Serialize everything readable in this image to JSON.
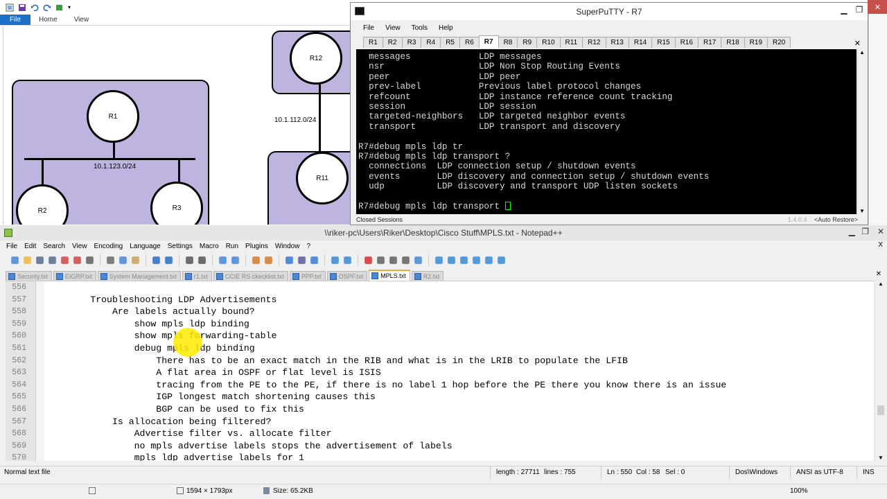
{
  "paint": {
    "tabs": [
      "File",
      "Home",
      "View"
    ],
    "status_size": "1594 × 1793px",
    "status_file": "Size: 65.2KB",
    "zoom": "100%",
    "diagram": {
      "routers": [
        "R1",
        "R2",
        "R3",
        "R12",
        "R11"
      ],
      "networks": [
        "10.1.123.0/24",
        "10.1.112.0/24"
      ]
    }
  },
  "putty": {
    "title": "SuperPuTTY - R7",
    "menu": [
      "File",
      "View",
      "Tools",
      "Help"
    ],
    "tabs": [
      "R1",
      "R2",
      "R3",
      "R4",
      "R5",
      "R6",
      "R7",
      "R8",
      "R9",
      "R10",
      "R11",
      "R12",
      "R13",
      "R14",
      "R15",
      "R16",
      "R17",
      "R18",
      "R19",
      "R20"
    ],
    "active_tab": "R7",
    "terminal_lines": [
      "  messages             LDP messages",
      "  nsr                  LDP Non Stop Routing Events",
      "  peer                 LDP peer",
      "  prev-label           Previous label protocol changes",
      "  refcount             LDP instance reference count tracking",
      "  session              LDP session",
      "  targeted-neighbors   LDP targeted neighbor events",
      "  transport            LDP transport and discovery",
      "",
      "R7#debug mpls ldp tr",
      "R7#debug mpls ldp transport ?",
      "  connections  LDP connection setup / shutdown events",
      "  events       LDP discovery and connection setup / shutdown events",
      "  udp          LDP discovery and transport UDP listen sockets",
      "",
      "R7#debug mpls ldp transport "
    ],
    "status_left": "Closed Sessions",
    "status_version": "1.4.0.4",
    "status_right": "<Auto Restore>"
  },
  "npp": {
    "title": "\\\\riker-pc\\Users\\Riker\\Desktop\\Cisco Stuff\\MPLS.txt - Notepad++",
    "menu": [
      "File",
      "Edit",
      "Search",
      "View",
      "Encoding",
      "Language",
      "Settings",
      "Macro",
      "Run",
      "Plugins",
      "Window",
      "?"
    ],
    "tabs": [
      "Security.txt",
      "EIGRP.txt",
      "System Management.txt",
      "r1.txt",
      "CCIE RS ckecklist.txt",
      "PPP.txt",
      "OSPF.txt",
      "MPLS.txt",
      "R2.txt"
    ],
    "active_tab": "MPLS.txt",
    "lines": [
      {
        "n": "556",
        "t": ""
      },
      {
        "n": "557",
        "t": "        Troubleshooting LDP Advertisements"
      },
      {
        "n": "558",
        "t": "            Are labels actually bound?"
      },
      {
        "n": "559",
        "t": "                show mpls ldp binding"
      },
      {
        "n": "560",
        "t": "                show mpls forwarding-table"
      },
      {
        "n": "561",
        "t": "                debug mpls ldp binding"
      },
      {
        "n": "562",
        "t": "                    There has to be an exact match in the RIB and what is in the LRIB to populate the LFIB"
      },
      {
        "n": "563",
        "t": "                    A flat area in OSPF or flat level is ISIS"
      },
      {
        "n": "564",
        "t": "                    tracing from the PE to the PE, if there is no label 1 hop before the PE there you know there is an issue"
      },
      {
        "n": "565",
        "t": "                    IGP longest match shortening causes this"
      },
      {
        "n": "566",
        "t": "                    BGP can be used to fix this"
      },
      {
        "n": "567",
        "t": "            Is allocation being filtered?"
      },
      {
        "n": "568",
        "t": "                Advertise filter vs. allocate filter"
      },
      {
        "n": "569",
        "t": "                no mpls advertise labels stops the advertisement of labels"
      },
      {
        "n": "570",
        "t": "                mpls ldp advertise labels for 1"
      }
    ],
    "status": {
      "type": "Normal text file",
      "length": "length : 27711",
      "lines": "lines : 755",
      "ln": "Ln : 550",
      "col": "Col : 58",
      "sel": "Sel : 0",
      "eol": "Dos\\Windows",
      "encoding": "ANSI as UTF-8",
      "mode": "INS"
    }
  },
  "colors": {
    "zone_fill": "#bfb4e0",
    "terminal_bg": "#000000",
    "terminal_fg": "#d9d9d9",
    "cursor": "#00ff00",
    "paint_file_tab": "#1e6fc7",
    "active_tab_accent": "#f6a53a"
  }
}
